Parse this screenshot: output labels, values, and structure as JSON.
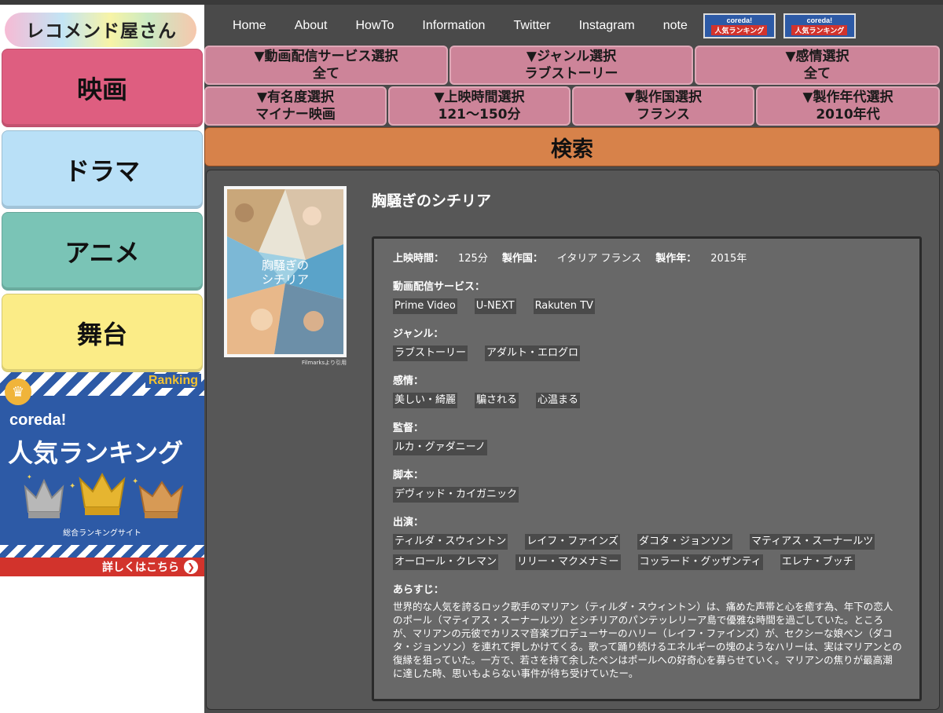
{
  "logo": {
    "text": "レコメンド屋さん"
  },
  "categories": [
    {
      "label": "映画",
      "color": "#de5e80"
    },
    {
      "label": "ドラマ",
      "color": "#b9e0f7"
    },
    {
      "label": "アニメ",
      "color": "#7ac4b6"
    },
    {
      "label": "舞台",
      "color": "#fbec87"
    }
  ],
  "ranking_banner": {
    "corner_label": "Ranking",
    "brand": "coreda!",
    "title": "人気ランキング",
    "subtitle": "総合ランキングサイト",
    "more_label": "詳しくはこちら"
  },
  "nav": {
    "links": [
      "Home",
      "About",
      "HowTo",
      "Information",
      "Twitter",
      "Instagram",
      "note"
    ],
    "badges": [
      {
        "brand": "coreda!",
        "label": "人気ランキング"
      },
      {
        "brand": "coreda!",
        "label": "人気ランキング"
      }
    ]
  },
  "filters": {
    "row1": [
      {
        "title": "▼動画配信サービス選択",
        "value": "全て"
      },
      {
        "title": "▼ジャンル選択",
        "value": "ラブストーリー"
      },
      {
        "title": "▼感情選択",
        "value": "全て"
      }
    ],
    "row2": [
      {
        "title": "▼有名度選択",
        "value": "マイナー映画"
      },
      {
        "title": "▼上映時間選択",
        "value": "121〜150分"
      },
      {
        "title": "▼製作国選択",
        "value": "フランス"
      },
      {
        "title": "▼製作年代選択",
        "value": "2010年代"
      }
    ]
  },
  "search_button": "検索",
  "movie": {
    "title": "胸騒ぎのシチリア",
    "poster_title": "胸騒ぎの シチリア",
    "poster_credit": "Filmarksより引用",
    "runtime_label": "上映時間：",
    "runtime": "125分",
    "country_label": "製作国：",
    "country": "イタリア フランス",
    "year_label": "製作年：",
    "year": "2015年",
    "streaming_label": "動画配信サービス：",
    "streaming": [
      "Prime Video",
      "U-NEXT",
      "Rakuten TV"
    ],
    "genre_label": "ジャンル：",
    "genres": [
      "ラブストーリー",
      "アダルト・エログロ"
    ],
    "emotion_label": "感情：",
    "emotions": [
      "美しい・綺麗",
      "騙される",
      "心温まる"
    ],
    "director_label": "監督：",
    "directors": [
      "ルカ・グァダニーノ"
    ],
    "writer_label": "脚本：",
    "writers": [
      "デヴィッド・カイガニック"
    ],
    "cast_label": "出演：",
    "cast": [
      "ティルダ・スウィントン",
      "レイフ・ファインズ",
      "ダコタ・ジョンソン",
      "マティアス・スーナールツ",
      "オーロール・クレマン",
      "リリー・マクメナミー",
      "コッラード・グッザンティ",
      "エレナ・ブッチ"
    ],
    "synopsis_label": "あらすじ：",
    "synopsis": "世界的な人気を誇るロック歌手のマリアン（ティルダ・スウィントン）は、痛めた声帯と心を癒す為、年下の恋人のポール（マティアス・スーナールツ）とシチリアのパンテッレリーア島で優雅な時間を過ごしていた。ところが、マリアンの元彼でカリスマ音楽プロデューサーのハリー（レイフ・ファインズ）が、セクシーな娘ペン（ダコタ・ジョンソン）を連れて押しかけてくる。歌って踊り続けるエネルギーの塊のようなハリーは、実はマリアンとの復縁を狙っていた。一方で、若さを持て余したペンはポールへの好奇心を募らせていく。マリアンの焦りが最高潮に達した時、思いもよらない事件が待ち受けていたー。"
  }
}
